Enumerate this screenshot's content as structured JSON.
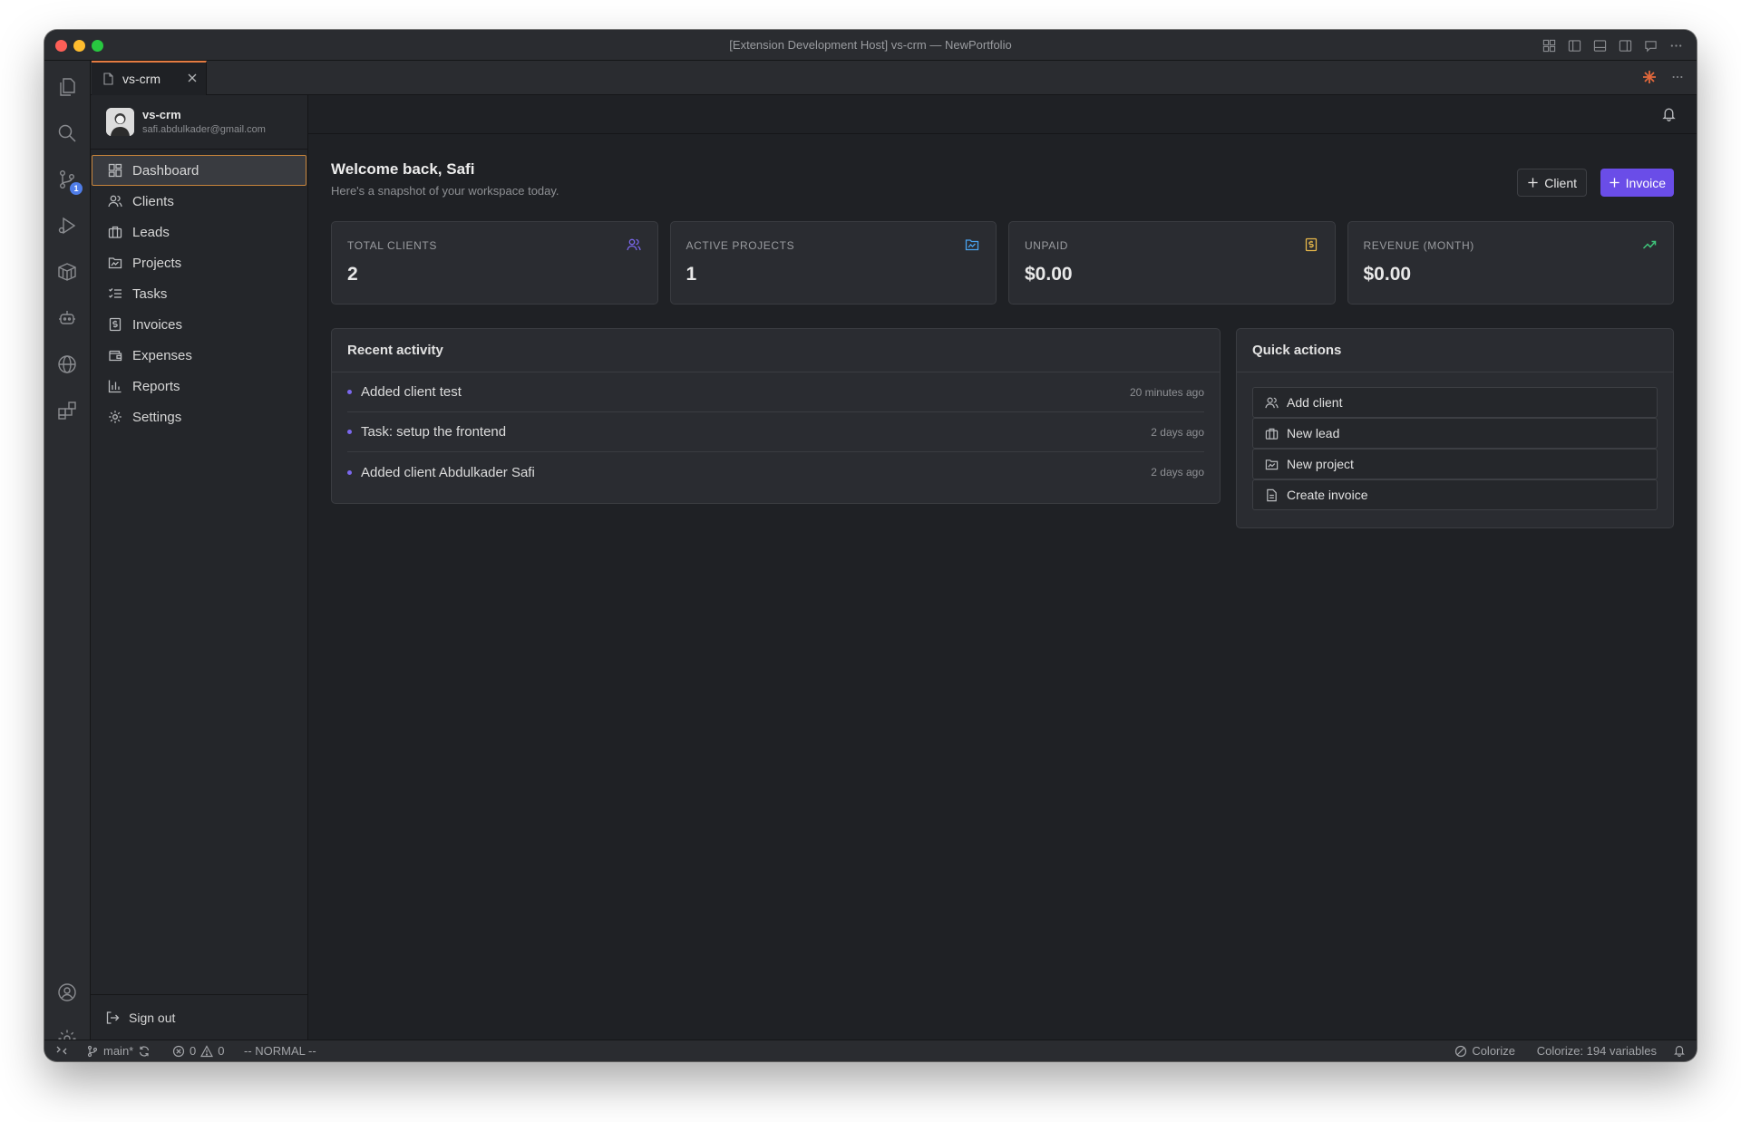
{
  "window": {
    "title": "[Extension Development Host] vs-crm — NewPortfolio"
  },
  "activity_bar": {
    "source_control_badge": "1"
  },
  "editor_tab": {
    "label": "vs-crm"
  },
  "profile": {
    "name": "vs-crm",
    "email": "safi.abdulkader@gmail.com"
  },
  "nav": {
    "items": [
      {
        "label": "Dashboard",
        "icon": "dashboard-icon",
        "active": true
      },
      {
        "label": "Clients",
        "icon": "users-icon"
      },
      {
        "label": "Leads",
        "icon": "briefcase-icon"
      },
      {
        "label": "Projects",
        "icon": "folder-icon"
      },
      {
        "label": "Tasks",
        "icon": "checklist-icon"
      },
      {
        "label": "Invoices",
        "icon": "dollar-doc-icon"
      },
      {
        "label": "Expenses",
        "icon": "wallet-icon"
      },
      {
        "label": "Reports",
        "icon": "bar-chart-icon"
      },
      {
        "label": "Settings",
        "icon": "gear-icon"
      }
    ],
    "sign_out": "Sign out"
  },
  "header": {
    "welcome": "Welcome back, Safi",
    "subtitle": "Here's a snapshot of your workspace today.",
    "client_button": "Client",
    "invoice_button": "Invoice"
  },
  "stats": [
    {
      "label": "TOTAL CLIENTS",
      "value": "2",
      "icon": "users-icon",
      "color": "#7b68ee"
    },
    {
      "label": "ACTIVE PROJECTS",
      "value": "1",
      "icon": "folder-icon",
      "color": "#4aa3f0"
    },
    {
      "label": "UNPAID",
      "value": "$0.00",
      "icon": "dollar-doc-icon",
      "color": "#e8b84a"
    },
    {
      "label": "REVENUE (MONTH)",
      "value": "$0.00",
      "icon": "trending-up-icon",
      "color": "#3fc47a"
    }
  ],
  "recent_activity": {
    "title": "Recent activity",
    "items": [
      {
        "text": "Added client test",
        "time": "20 minutes ago"
      },
      {
        "text": "Task: setup the frontend",
        "time": "2 days ago"
      },
      {
        "text": "Added client Abdulkader Safi",
        "time": "2 days ago"
      }
    ]
  },
  "quick_actions": {
    "title": "Quick actions",
    "items": [
      {
        "label": "Add client",
        "icon": "users-icon"
      },
      {
        "label": "New lead",
        "icon": "briefcase-icon"
      },
      {
        "label": "New project",
        "icon": "folder-icon"
      },
      {
        "label": "Create invoice",
        "icon": "document-icon"
      }
    ]
  },
  "status_bar": {
    "branch": "main*",
    "errors": "0",
    "warnings": "0",
    "mode": "-- NORMAL --",
    "colorize": "Colorize",
    "colorize_count": "Colorize: 194 variables"
  },
  "colors": {
    "accent": "#6a4de8",
    "active_border": "#c6843b",
    "tab_border": "#e47b41"
  }
}
